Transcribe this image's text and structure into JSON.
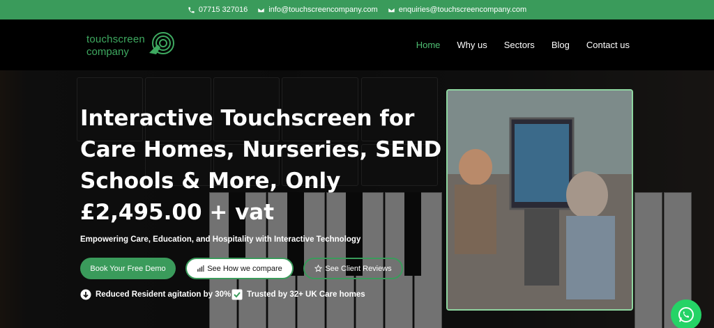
{
  "topbar": {
    "phone": "07715 327016",
    "email_info": "info@touchscreencompany.com",
    "email_enquiries": "enquiries@touchscreencompany.com"
  },
  "logo": {
    "line1": "touchscreen",
    "line2": "company"
  },
  "nav": {
    "items": [
      {
        "label": "Home",
        "active": true
      },
      {
        "label": "Why us",
        "active": false
      },
      {
        "label": "Sectors",
        "active": false
      },
      {
        "label": "Blog",
        "active": false
      },
      {
        "label": "Contact us",
        "active": false
      }
    ]
  },
  "hero": {
    "title": "Interactive Touchscreen for Care Homes, Nurseries, SEND Schools & More, Only £2,495.00 + vat",
    "subtitle": "Empowering Care, Education, and Hospitality with Interactive Technology",
    "buttons": {
      "demo": "Book Your Free Demo",
      "compare": "See How we compare",
      "reviews": "See Client Reviews"
    },
    "features": {
      "f1": "Reduced Resident agitation by 30%",
      "f2": "Trusted by 32+ UK Care homes"
    }
  },
  "colors": {
    "brand_green": "#3a9b5b",
    "active_nav": "#4fbf73"
  },
  "icons": [
    "phone-icon",
    "envelope-icon",
    "envelope-icon",
    "chart-icon",
    "star-icon",
    "arrow-down-circle-icon",
    "checkbox-icon",
    "whatsapp-icon"
  ]
}
